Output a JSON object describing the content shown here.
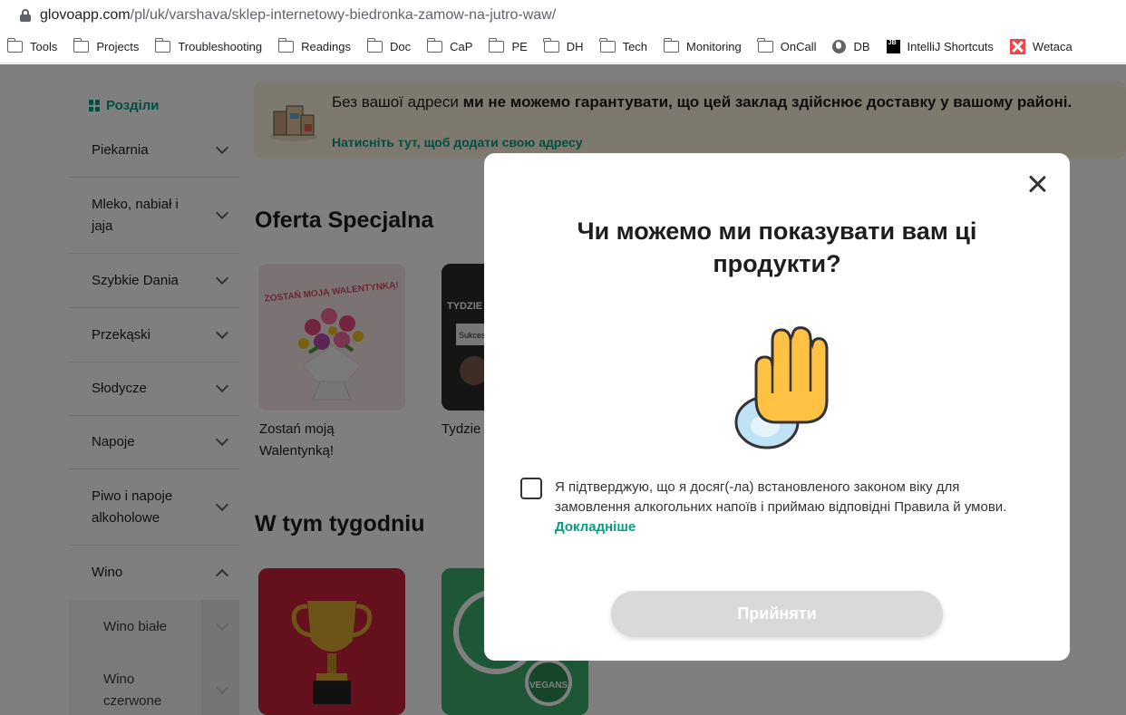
{
  "browser": {
    "url_host": "glovoapp.com",
    "url_path": "/pl/uk/varshava/sklep-internetowy-biedronka-zamow-na-jutro-waw/",
    "bookmarks": [
      {
        "label": "Tools",
        "icon": "folder-icon"
      },
      {
        "label": "Projects",
        "icon": "folder-icon"
      },
      {
        "label": "Troubleshooting",
        "icon": "folder-icon"
      },
      {
        "label": "Readings",
        "icon": "folder-icon"
      },
      {
        "label": "Doc",
        "icon": "folder-icon"
      },
      {
        "label": "CaP",
        "icon": "folder-icon"
      },
      {
        "label": "PE",
        "icon": "folder-icon"
      },
      {
        "label": "DH",
        "icon": "folder-icon"
      },
      {
        "label": "Tech",
        "icon": "folder-icon"
      },
      {
        "label": "Monitoring",
        "icon": "folder-icon"
      },
      {
        "label": "OnCall",
        "icon": "folder-icon"
      },
      {
        "label": "DB",
        "icon": "globe-icon"
      },
      {
        "label": "IntelliJ Shortcuts",
        "icon": "jetbrains-icon",
        "icon_text": "JB"
      },
      {
        "label": "Wetaca",
        "icon": "wetaca-icon"
      }
    ]
  },
  "sidebar": {
    "title": "Розділи",
    "categories": [
      {
        "label": "Piekarnia"
      },
      {
        "label": "Mleko, nabiał i jaja"
      },
      {
        "label": "Szybkie Dania"
      },
      {
        "label": "Przekąski"
      },
      {
        "label": "Słodycze"
      },
      {
        "label": "Napoje"
      },
      {
        "label": "Piwo i napoje alkoholowe"
      },
      {
        "label": "Wino"
      }
    ],
    "subcategories": [
      {
        "label": "Wino białe"
      },
      {
        "label": "Wino czerwone"
      }
    ]
  },
  "banner": {
    "text_normal": "Без вашої адреси ",
    "text_bold": "ми не можемо гарантувати, що цей заклад здійснює доставку у вашому районі.",
    "link": "Натисніть тут, щоб додати свою адресу"
  },
  "sections": {
    "offer_title": "Oferta Specjalna",
    "week_title": "W tym tygodniu",
    "offer_items": [
      {
        "label": "Zostań moją Walentynką!",
        "image_text": "ZOSTAŃ MOJĄ WALENTYNKĄ!"
      },
      {
        "label": "Tydzie",
        "image_text": "TYDZIE",
        "image_text_2": "Sukces"
      }
    ],
    "week_items": [
      {
        "image": "trophy"
      },
      {
        "image_text": "VEGANS"
      }
    ]
  },
  "modal": {
    "title": "Чи можемо ми показувати вам ці продукти?",
    "consent_text": "Я підтверджую, що я досяг(-ла) встановленого законом віку для замовлення алкогольних напоїв і приймаю відповідні Правила й умови. ",
    "consent_link": "Докладніше",
    "accept_label": "Прийняти",
    "checkbox_checked": false
  },
  "colors": {
    "brand_green": "#00a082",
    "banner_bg": "#fdf3de",
    "hand_yellow": "#ffc244",
    "button_disabled": "#d9d9d9"
  }
}
